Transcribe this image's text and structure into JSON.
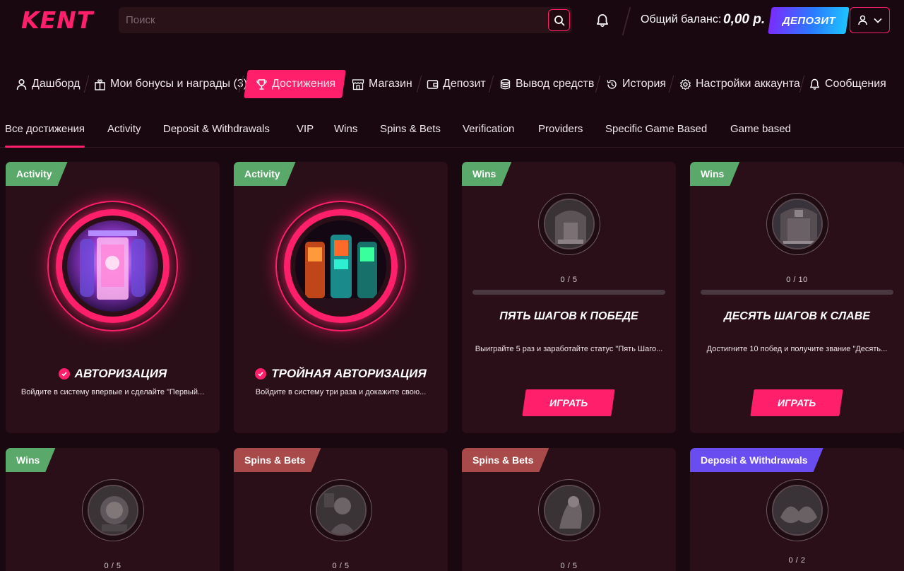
{
  "header": {
    "logo": "KENT",
    "search_placeholder": "Поиск",
    "balance_label": "Общий баланс:",
    "balance_value": "0,00 р.",
    "deposit_label": "ДЕПОЗИТ"
  },
  "nav": {
    "items": [
      {
        "label": "Дашборд",
        "icon": "user-icon"
      },
      {
        "label": "Мои бонусы и награды (3)",
        "icon": "gift-icon"
      },
      {
        "label": "Достижения",
        "icon": "trophy-icon",
        "active": true
      },
      {
        "label": "Магазин",
        "icon": "store-icon"
      },
      {
        "label": "Депозит",
        "icon": "wallet-icon"
      },
      {
        "label": "Вывод средств",
        "icon": "coins-icon"
      },
      {
        "label": "История",
        "icon": "history-icon"
      },
      {
        "label": "Настройки аккаунта",
        "icon": "gear-icon"
      },
      {
        "label": "Сообщения",
        "icon": "bell-icon"
      }
    ]
  },
  "tabs": [
    "Все достижения",
    "Activity",
    "Deposit & Withdrawals",
    "VIP",
    "Wins",
    "Spins & Bets",
    "Verification",
    "Providers",
    "Specific Game Based",
    "Game based"
  ],
  "active_tab": "Все достижения",
  "cards": [
    {
      "tag": "Activity",
      "tag_color": "#5aa86a",
      "completed": true,
      "title": "АВТОРИЗАЦИЯ",
      "description": "Войдите в систему впервые и сделайте \"Первый..."
    },
    {
      "tag": "Activity",
      "tag_color": "#5aa86a",
      "completed": true,
      "title": "ТРОЙНАЯ АВТОРИЗАЦИЯ",
      "description": "Войдите в систему три раза и докажите свою..."
    },
    {
      "tag": "Wins",
      "tag_color": "#5aa86a",
      "completed": false,
      "progress": "0 / 5",
      "progress_fraction": 0,
      "title": "ПЯТЬ ШАГОВ К ПОБЕДЕ",
      "description": "Выиграйте 5 раз и заработайте статус \"Пять Шаго...",
      "button": "ИГРАТЬ"
    },
    {
      "tag": "Wins",
      "tag_color": "#5aa86a",
      "completed": false,
      "progress": "0 / 10",
      "progress_fraction": 0,
      "title": "ДЕСЯТЬ ШАГОВ К СЛАВЕ",
      "description": "Достигните 10 побед и получите звание \"Десять...",
      "button": "ИГРАТЬ"
    },
    {
      "tag": "Wins",
      "tag_color": "#5aa86a",
      "progress": "0 / 5"
    },
    {
      "tag": "Spins & Bets",
      "tag_color": "#a84a4a",
      "progress": "0 / 5"
    },
    {
      "tag": "Spins & Bets",
      "tag_color": "#a84a4a",
      "progress": "0 / 5"
    },
    {
      "tag": "Deposit & Withdrawals",
      "tag_color": "#6a4df0",
      "progress": "0 / 2"
    }
  ],
  "colors": {
    "accent": "#ff1f6b",
    "background": "#1a0810",
    "card": "#2b0f18"
  }
}
